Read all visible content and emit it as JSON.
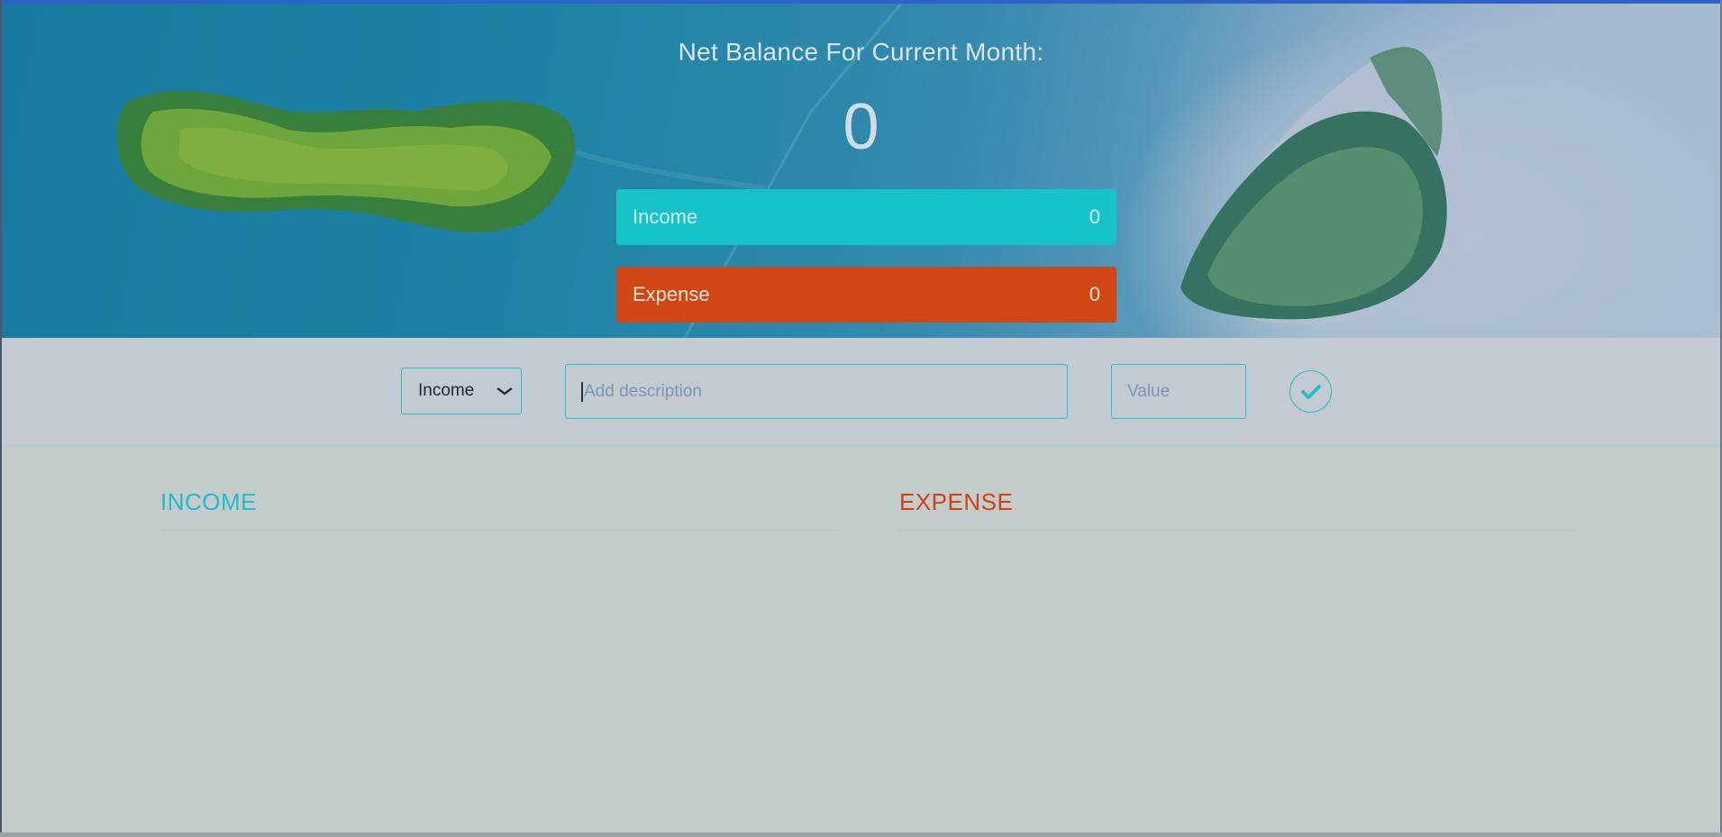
{
  "header": {
    "title": "Net Balance For Current Month:",
    "balance": "0"
  },
  "summary": {
    "income": {
      "label": "Income",
      "value": "0",
      "color": "#15c3c9"
    },
    "expense": {
      "label": "Expense",
      "value": "0",
      "color": "#ce4714"
    }
  },
  "form": {
    "type_select": {
      "selected": "Income"
    },
    "description": {
      "placeholder": "Add description",
      "value": ""
    },
    "value": {
      "placeholder": "Value",
      "value": ""
    },
    "submit_icon": "checkmark-icon"
  },
  "lists": {
    "income_title": "INCOME",
    "expense_title": "EXPENSE",
    "income_items": [],
    "expense_items": []
  },
  "colors": {
    "accent": "#25c0c6",
    "income": "#20bcc7",
    "expense": "#cc4416"
  }
}
